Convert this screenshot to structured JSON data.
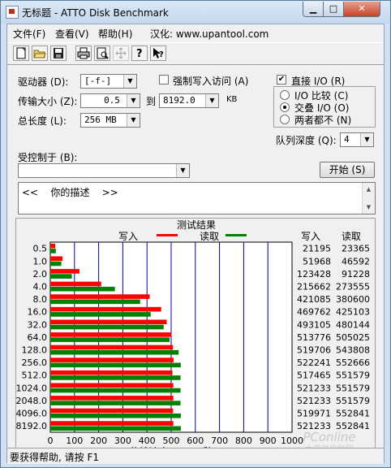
{
  "window": {
    "title": "无标题 - ATTO Disk Benchmark",
    "min_glyph": "▁",
    "max_glyph": "□",
    "close_glyph": "✕"
  },
  "menu": {
    "file": "文件(F)",
    "view": "查看(V)",
    "help": "帮助(H)",
    "localization": "汉化: www.upantool.com"
  },
  "toolbar": {
    "icons": [
      "new-document-icon",
      "open-folder-icon",
      "save-disk-icon",
      "print-icon",
      "print-preview-icon",
      "move-icon",
      "help-question-icon",
      "context-help-icon"
    ]
  },
  "form": {
    "drive_label": "驱动器 (D):",
    "drive_value": "[-f-]",
    "transfer_size_label": "传输大小 (Z):",
    "transfer_from": "0.5",
    "to_label": "到",
    "transfer_to": "8192.0",
    "kb_unit": "KB",
    "total_length_label": "总长度 (L):",
    "total_length_value": "256 MB",
    "force_write_access_label": "强制写入访问 (A)",
    "force_write_access_checked": false,
    "direct_io_label": "直接 I/O (R)",
    "direct_io_checked": true,
    "io_compare_label": "I/O 比较 (C)",
    "overlapped_io_label": "交叠 I/O (O)",
    "neither_label": "两者都不 (N)",
    "selected_mode": "overlapped_io",
    "queue_depth_label": "队列深度 (Q):",
    "queue_depth_value": "4",
    "controlled_by_label": "受控制于 (B):",
    "controlled_by_value": "",
    "start_button": "开始 (S)",
    "description_text": "<<    你的描述    >>",
    "arrow_down": "▼",
    "arrow_up": "▲",
    "check_mark": "✔"
  },
  "results": {
    "title": "测试结果",
    "write_legend": "写入",
    "read_legend": "读取",
    "write_header": "写入",
    "read_header": "读取",
    "write_color": "#ff0000",
    "read_color": "#008000",
    "grid_color": "#0000a0"
  },
  "chart_data": {
    "type": "bar",
    "orientation": "horizontal",
    "title": "测试结果",
    "xlabel": "传输速率 - MB / 秒",
    "xlim": [
      0,
      1000
    ],
    "xticks": [
      0,
      100,
      200,
      300,
      400,
      500,
      600,
      700,
      800,
      900,
      1000
    ],
    "categories": [
      "0.5",
      "1.0",
      "2.0",
      "4.0",
      "8.0",
      "16.0",
      "32.0",
      "64.0",
      "128.0",
      "256.0",
      "512.0",
      "1024.0",
      "2048.0",
      "4096.0",
      "8192.0"
    ],
    "series": [
      {
        "name": "写入",
        "color": "#ff0000",
        "values": [
          21195,
          51968,
          123428,
          215662,
          421085,
          469762,
          493105,
          513776,
          519706,
          522241,
          517465,
          521233,
          521233,
          519971,
          521233
        ]
      },
      {
        "name": "读取",
        "color": "#008000",
        "values": [
          23365,
          46592,
          91228,
          273555,
          380600,
          425103,
          480144,
          505025,
          543808,
          552666,
          551579,
          551579,
          551579,
          552841,
          552841
        ]
      }
    ],
    "value_unit": "KB/s",
    "legend": "top"
  },
  "status": {
    "text": "要获得帮助, 请按 F1"
  },
  "watermark": {
    "line1": "PConline",
    "line2": "太平洋电脑网"
  }
}
